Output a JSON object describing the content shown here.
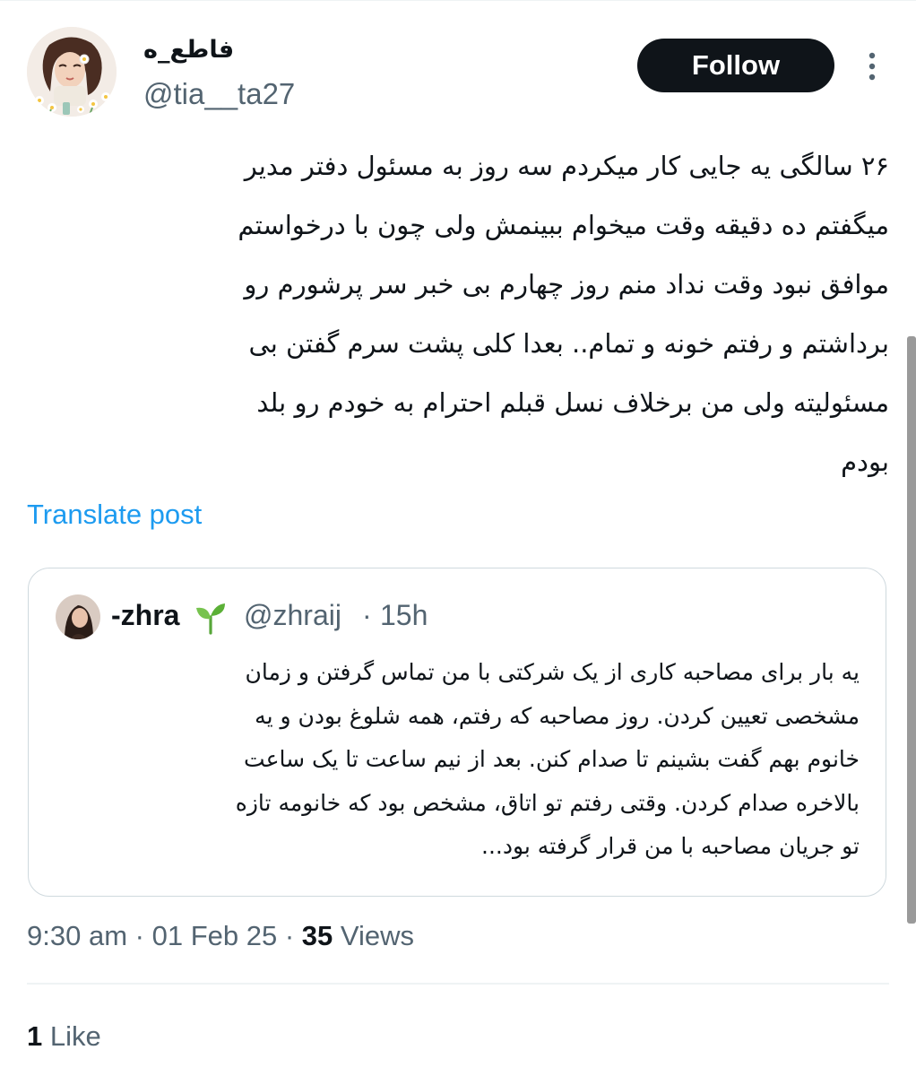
{
  "author": {
    "display_name": "فاطع_ه",
    "handle": "@tia__ta27"
  },
  "follow_label": "Follow",
  "tweet": {
    "lines": [
      "۲۶ سالگی یه جایی کار میکردم سه روز به مسئول دفتر مدیر",
      "میگفتم ده دقیقه وقت میخوام ببینمش ولی چون با درخواستم",
      "موافق نبود وقت نداد منم روز چهارم بی خبر سر پرشورم رو",
      "برداشتم و رفتم خونه و تمام.. بعدا کلی پشت سرم گفتن بی",
      "مسئولیته ولی من برخلاف نسل قبلم احترام به خودم رو بلد",
      "بودم"
    ],
    "translate_label": "Translate post"
  },
  "quote": {
    "name": "-zhra",
    "emoji": "seedling-icon",
    "handle": "@zhraij",
    "separator": "·",
    "time": "15h",
    "lines": [
      "یه بار برای مصاحبه کاری از یک شرکتی با من تماس گرفتن و زمان",
      "مشخصی تعیین کردن. روز مصاحبه که رفتم، همه شلوغ بودن و یه",
      "خانوم بهم گفت بشینم تا صدام کنن. بعد از نیم ساعت تا یک ساعت",
      "بالاخره صدام کردن. وقتی رفتم تو اتاق، مشخص بود که خانومه تازه",
      "تو جریان مصاحبه با من قرار گرفته بود..."
    ]
  },
  "meta": {
    "time": "9:30 am",
    "sep1": "·",
    "date": "01 Feb 25",
    "sep2": "·",
    "views_count": "35",
    "views_label": "Views"
  },
  "likes": {
    "count": "1",
    "label": "Like"
  },
  "colors": {
    "text": "#0f1419",
    "secondary": "#536471",
    "accent": "#1d9bf0",
    "button_bg": "#0f1419",
    "border": "#cfd9de"
  }
}
